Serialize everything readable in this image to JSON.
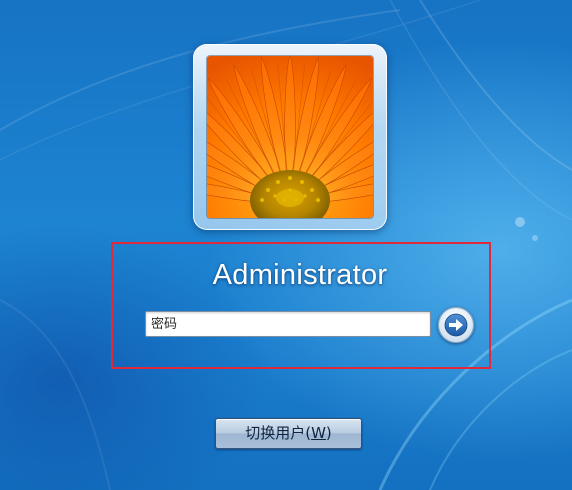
{
  "login": {
    "username": "Administrator",
    "password_placeholder": "密码",
    "password_value": "",
    "switch_user_label": "切换用户(",
    "switch_user_accel": "W",
    "switch_user_close": ")"
  },
  "colors": {
    "highlight": "#e02a3a",
    "background": "#1e7bc8"
  },
  "icons": {
    "avatar": "orange-gerbera-flower",
    "submit": "right-arrow-icon"
  }
}
